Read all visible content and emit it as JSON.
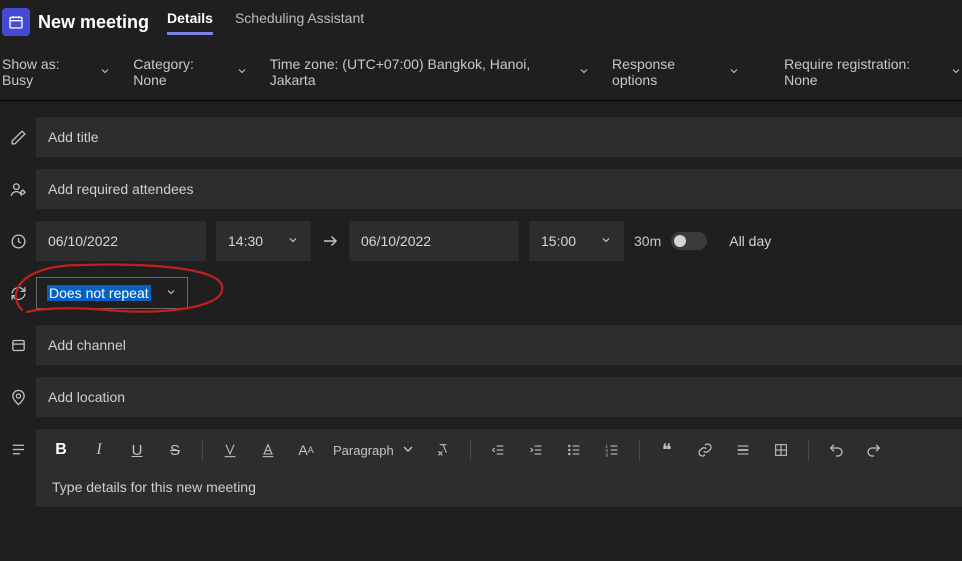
{
  "header": {
    "title": "New meeting",
    "tabs": {
      "details": "Details",
      "scheduling": "Scheduling Assistant"
    }
  },
  "options": {
    "show_as": "Show as: Busy",
    "category": "Category: None",
    "timezone": "Time zone: (UTC+07:00) Bangkok, Hanoi, Jakarta",
    "response": "Response options",
    "registration": "Require registration: None"
  },
  "fields": {
    "title_placeholder": "Add title",
    "attendees_placeholder": "Add required attendees",
    "start_date": "06/10/2022",
    "start_time": "14:30",
    "end_date": "06/10/2022",
    "end_time": "15:00",
    "duration": "30m",
    "allday": "All day",
    "recurrence": "Does not repeat",
    "channel_placeholder": "Add channel",
    "location_placeholder": "Add location",
    "details_placeholder": "Type details for this new meeting"
  },
  "toolbar": {
    "paragraph": "Paragraph"
  }
}
